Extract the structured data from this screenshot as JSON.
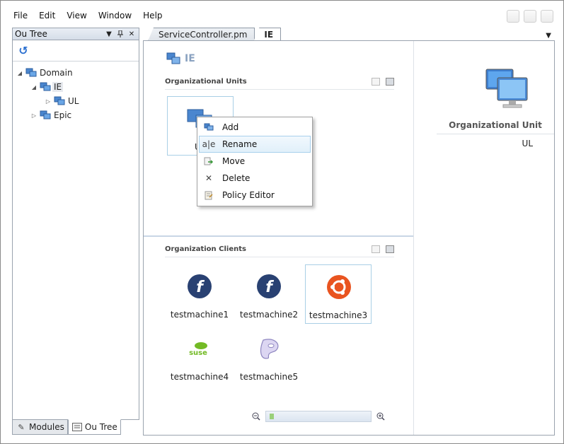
{
  "menu": [
    "File",
    "Edit",
    "View",
    "Window",
    "Help"
  ],
  "tree_panel": {
    "title": "Ou Tree",
    "nodes": [
      {
        "label": "Domain",
        "level": 0,
        "expanded": true
      },
      {
        "label": "IE",
        "level": 1,
        "expanded": true,
        "selected": true
      },
      {
        "label": "UL",
        "level": 2,
        "expanded": false
      },
      {
        "label": "Epic",
        "level": 1,
        "expanded": false
      }
    ]
  },
  "bottom_tabs": [
    "Modules",
    "Ou Tree"
  ],
  "doc_tabs": [
    "ServiceController.pm",
    "IE"
  ],
  "page": {
    "title": "IE",
    "ou_section": "Organizational Units",
    "clients_section": "Organization Clients",
    "ou_tile_label": "UL"
  },
  "context_menu": [
    {
      "label": "Add",
      "icon": "add-ou-icon"
    },
    {
      "label": "Rename",
      "icon": "rename-icon",
      "hover": true
    },
    {
      "label": "Move",
      "icon": "move-icon"
    },
    {
      "label": "Delete",
      "icon": "delete-icon"
    },
    {
      "label": "Policy Editor",
      "icon": "policy-editor-icon"
    }
  ],
  "clients": [
    {
      "name": "testmachine1",
      "os": "fedora"
    },
    {
      "name": "testmachine2",
      "os": "fedora"
    },
    {
      "name": "testmachine3",
      "os": "ubuntu",
      "selected": true
    },
    {
      "name": "testmachine4",
      "os": "suse"
    },
    {
      "name": "testmachine5",
      "os": "gentoo"
    }
  ],
  "details": {
    "title": "Organizational Unit",
    "value": "UL"
  },
  "zoom": {
    "level": 0.02
  },
  "colors": {
    "accent": "#2a6fd0",
    "selection_border": "#a9cfe6",
    "fedora": "#294172",
    "ubuntu": "#e95420",
    "suse": "#73ba25"
  }
}
